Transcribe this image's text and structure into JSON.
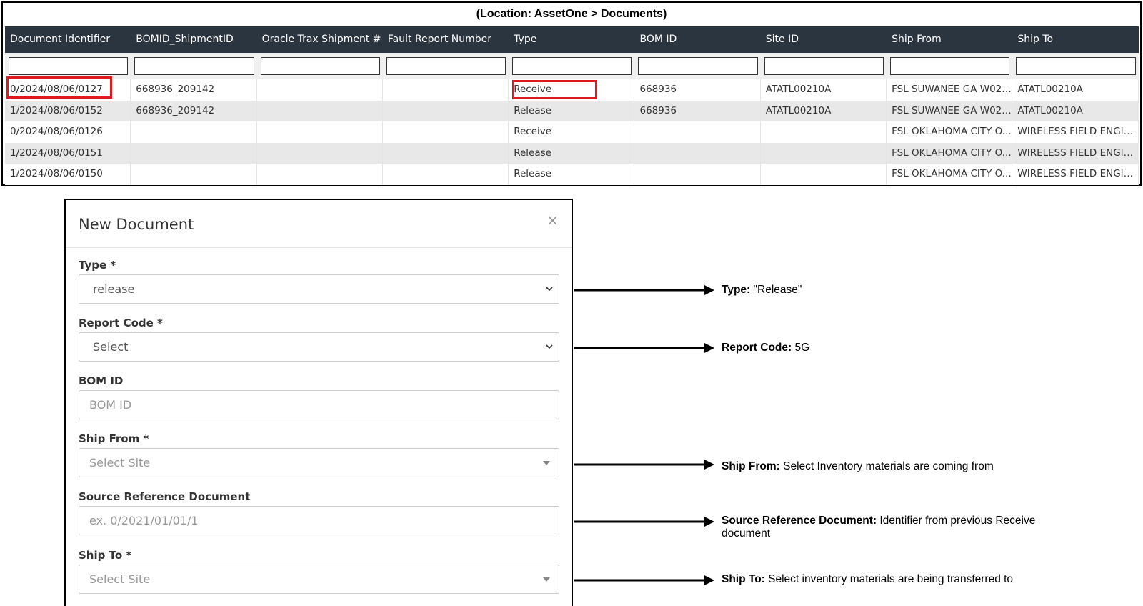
{
  "location_label": "(Location: AssetOne > Documents)",
  "grid": {
    "columns": [
      "Document Identifier",
      "BOMID_ShipmentID",
      "Oracle Trax Shipment #",
      "Fault Report Number",
      "Type",
      "BOM ID",
      "Site ID",
      "Ship From",
      "Ship To"
    ],
    "rows": [
      [
        "0/2024/08/06/0127",
        "668936_209142",
        "",
        "",
        "Receive",
        "668936",
        "ATATL00210A",
        "FSL SUWANEE GA W02 -...",
        "ATATL00210A"
      ],
      [
        "1/2024/08/06/0152",
        "668936_209142",
        "",
        "",
        "Release",
        "668936",
        "ATATL00210A",
        "FSL SUWANEE GA W02 -...",
        "ATATL00210A"
      ],
      [
        "0/2024/08/06/0126",
        "",
        "",
        "",
        "Receive",
        "",
        "",
        "FSL OKLAHOMA CITY O...",
        "WIRELESS FIELD ENGIN..."
      ],
      [
        "1/2024/08/06/0151",
        "",
        "",
        "",
        "Release",
        "",
        "",
        "FSL OKLAHOMA CITY O...",
        "WIRELESS FIELD ENGIN..."
      ],
      [
        "1/2024/08/06/0150",
        "",
        "",
        "",
        "Release",
        "",
        "",
        "FSL OKLAHOMA CITY O...",
        "WIRELESS FIELD ENGIN..."
      ]
    ]
  },
  "modal": {
    "title": "New Document",
    "close": "×",
    "type": {
      "label": "Type *",
      "value": "release"
    },
    "report_code": {
      "label": "Report Code *",
      "value": "Select"
    },
    "bom_id": {
      "label": "BOM ID",
      "placeholder": "BOM ID"
    },
    "ship_from": {
      "label": "Ship From *",
      "placeholder": "Select Site"
    },
    "source_ref": {
      "label": "Source Reference Document",
      "placeholder": "ex. 0/2021/01/01/1"
    },
    "ship_to": {
      "label": "Ship To *",
      "placeholder": "Select Site"
    }
  },
  "annotations": {
    "type": {
      "key": "Type:",
      "text": " \"Release\""
    },
    "report_code": {
      "key": "Report Code:",
      "text": " 5G"
    },
    "ship_from": {
      "key": "Ship From:",
      "text": " Select Inventory materials are coming from"
    },
    "source_ref": {
      "key": "Source Reference Document:",
      "text": " Identifier from previous Receive",
      "text2": "document"
    },
    "ship_to": {
      "key": "Ship To:",
      "text": " Select inventory materials are being transferred to"
    }
  },
  "colors": {
    "header_bg": "#2b3540",
    "highlight": "#e0191f",
    "row_alt": "#e8e8e8"
  }
}
